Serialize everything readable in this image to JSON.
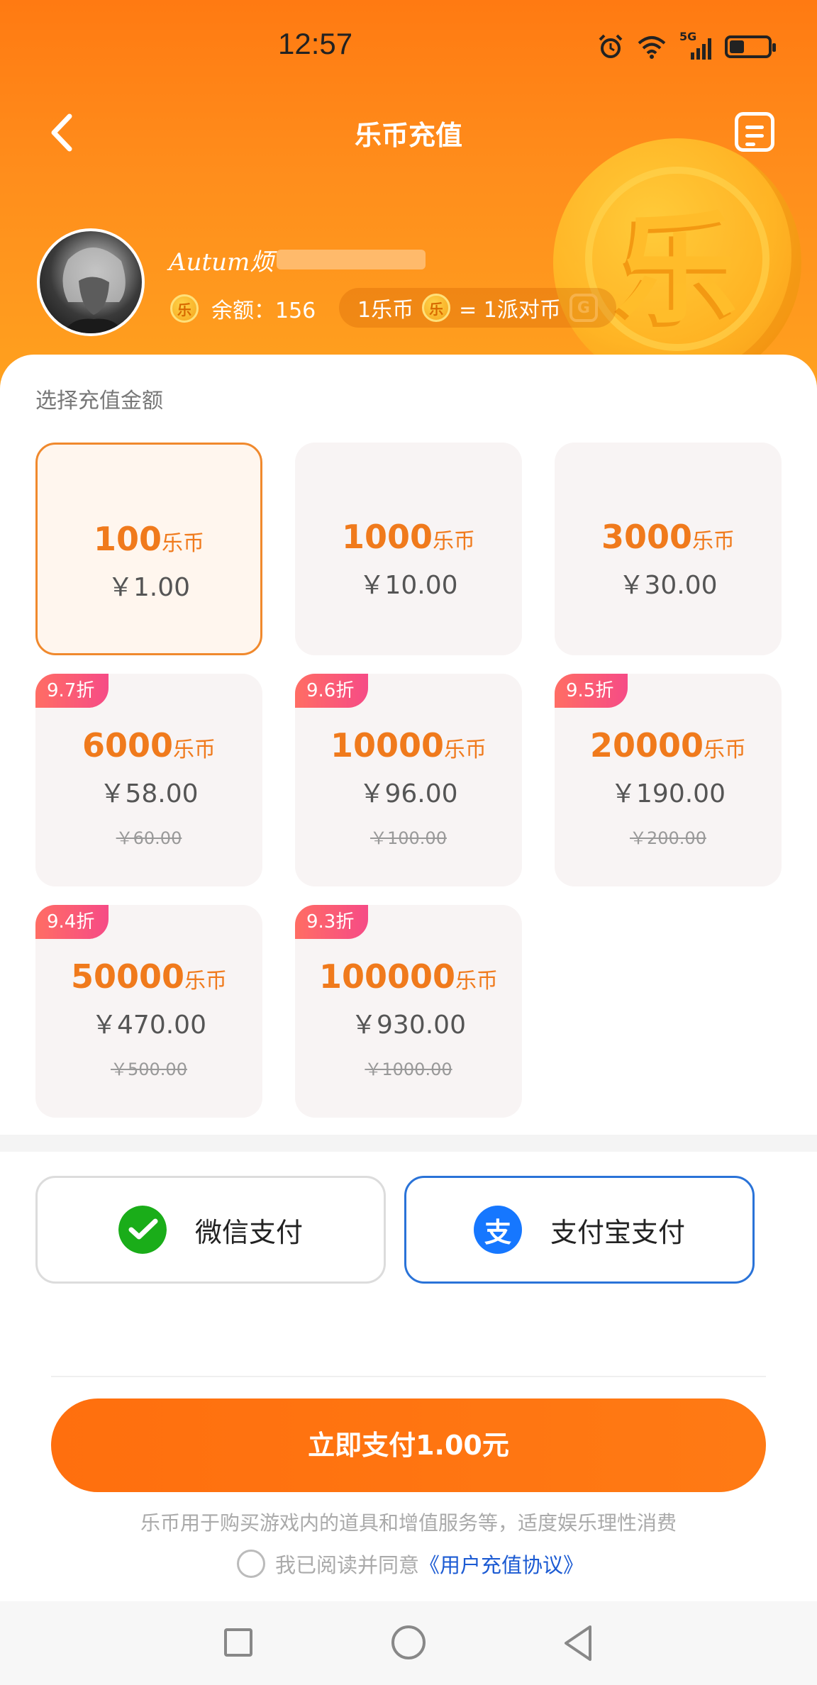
{
  "status_bar": {
    "time": "12:57",
    "network": "5G"
  },
  "nav": {
    "title": "乐币充值"
  },
  "user": {
    "name": "Autum烦",
    "balance_label": "余额：156",
    "coin_icon_char": "乐",
    "exchange_left": "1乐币",
    "exchange_right": "= 1派对币",
    "party_icon_char": "G"
  },
  "decor": {
    "big_coin_char": "乐"
  },
  "section": {
    "title": "选择充值金额"
  },
  "packages": [
    {
      "coins": "100",
      "unit": "乐币",
      "price": "￥1.00",
      "original": "",
      "badge": "",
      "selected": true
    },
    {
      "coins": "1000",
      "unit": "乐币",
      "price": "￥10.00",
      "original": "",
      "badge": ""
    },
    {
      "coins": "3000",
      "unit": "乐币",
      "price": "￥30.00",
      "original": "",
      "badge": ""
    },
    {
      "coins": "6000",
      "unit": "乐币",
      "price": "￥58.00",
      "original": "￥60.00",
      "badge": "9.7折"
    },
    {
      "coins": "10000",
      "unit": "乐币",
      "price": "￥96.00",
      "original": "￥100.00",
      "badge": "9.6折"
    },
    {
      "coins": "20000",
      "unit": "乐币",
      "price": "￥190.00",
      "original": "￥200.00",
      "badge": "9.5折"
    },
    {
      "coins": "50000",
      "unit": "乐币",
      "price": "￥470.00",
      "original": "￥500.00",
      "badge": "9.4折"
    },
    {
      "coins": "100000",
      "unit": "乐币",
      "price": "￥930.00",
      "original": "￥1000.00",
      "badge": "9.3折"
    }
  ],
  "payment": {
    "wechat": {
      "label": "微信支付"
    },
    "alipay": {
      "label": "支付宝支付",
      "icon_char": "支",
      "selected": true
    }
  },
  "submit": {
    "label": "立即支付1.00元"
  },
  "notice": "乐币用于购买游戏内的道具和增值服务等，适度娱乐理性消费",
  "agreement": {
    "prefix": "我已阅读并同意",
    "link": "《用户充值协议》"
  },
  "colors": {
    "brand_orange": "#ff7a12",
    "alipay_blue": "#1677ff",
    "wechat_green": "#1aad19",
    "price_orange": "#f07a1c"
  }
}
